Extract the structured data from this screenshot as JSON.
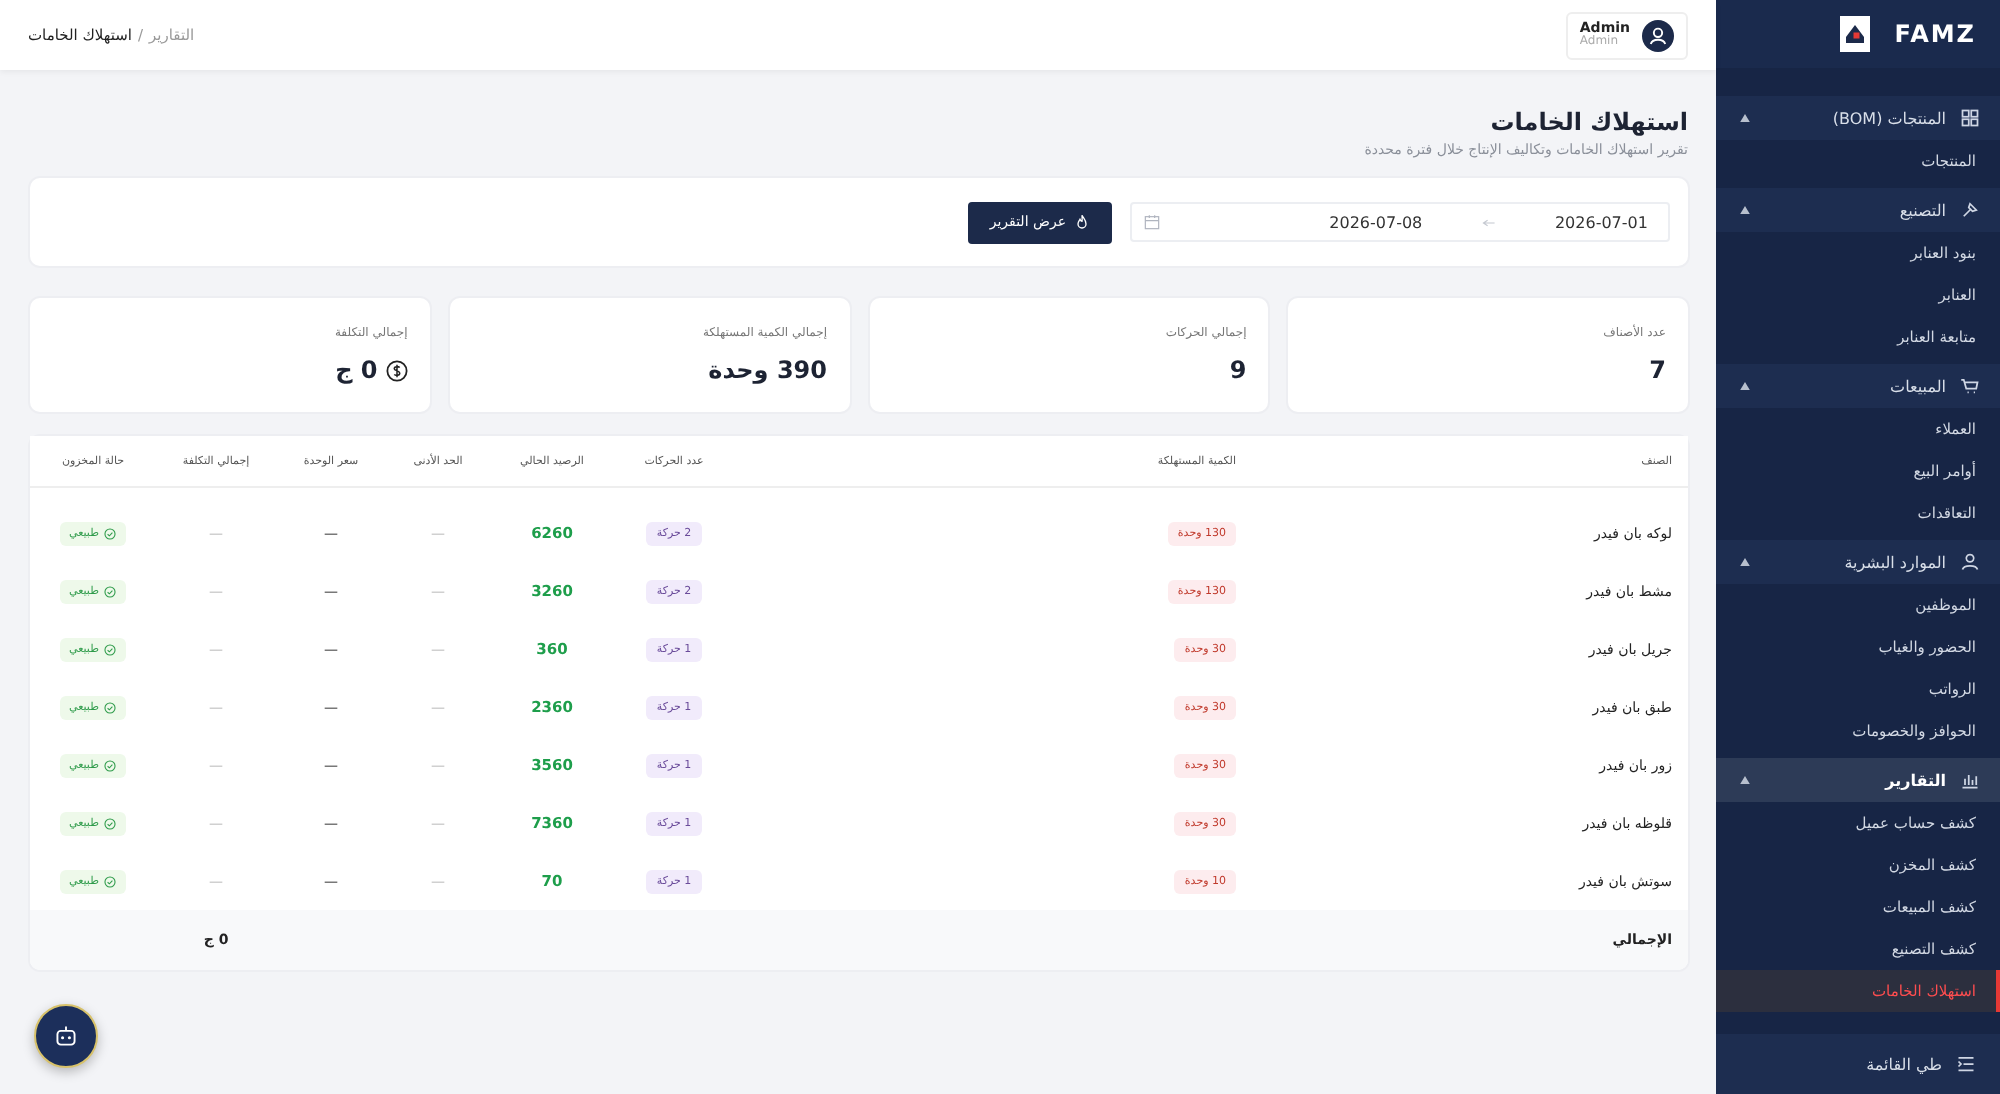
{
  "breadcrumb": {
    "parent": "التقارير",
    "separator": "/",
    "current": "استهلاك الخامات"
  },
  "user": {
    "name": "Admin",
    "role": "Admin"
  },
  "page": {
    "title": "استهلاك الخامات",
    "subtitle": "تقرير استهلاك الخامات وتكاليف الإنتاج خلال فترة محددة"
  },
  "filter": {
    "from": "2026-07-01",
    "to": "2026-07-08",
    "button": "عرض التقرير"
  },
  "stats": [
    {
      "label": "عدد الأصناف",
      "value": "7"
    },
    {
      "label": "إجمالي الحركات",
      "value": "9"
    },
    {
      "label": "إجمالي الكمية المستهلكة",
      "value": "390 وحدة"
    },
    {
      "label": "إجمالي التكلفة",
      "value": "0 ج",
      "kind": "money"
    }
  ],
  "table": {
    "columns": [
      "الصنف",
      "الكمية المستهلكة",
      "عدد الحركات",
      "الرصيد الحالي",
      "الحد الأدنى",
      "سعر الوحدة",
      "إجمالي التكلفة",
      "حالة المخزون"
    ],
    "rows": [
      {
        "item": "لوكه بان فيدر",
        "consumed": "130 وحدة",
        "moves": "2 حركة",
        "balance": "6260",
        "min": "—",
        "price": "—",
        "total": "—",
        "status": "طبيعي"
      },
      {
        "item": "مشط بان فيدر",
        "consumed": "130 وحدة",
        "moves": "2 حركة",
        "balance": "3260",
        "min": "—",
        "price": "—",
        "total": "—",
        "status": "طبيعي"
      },
      {
        "item": "جريل بان فيدر",
        "consumed": "30 وحدة",
        "moves": "1 حركة",
        "balance": "360",
        "min": "—",
        "price": "—",
        "total": "—",
        "status": "طبيعي"
      },
      {
        "item": "طبق بان فيدر",
        "consumed": "30 وحدة",
        "moves": "1 حركة",
        "balance": "2360",
        "min": "—",
        "price": "—",
        "total": "—",
        "status": "طبيعي"
      },
      {
        "item": "زور بان فيدر",
        "consumed": "30 وحدة",
        "moves": "1 حركة",
        "balance": "3560",
        "min": "—",
        "price": "—",
        "total": "—",
        "status": "طبيعي"
      },
      {
        "item": "قلوظه بان فيدر",
        "consumed": "30 وحدة",
        "moves": "1 حركة",
        "balance": "7360",
        "min": "—",
        "price": "—",
        "total": "—",
        "status": "طبيعي"
      },
      {
        "item": "سوتش بان فيدر",
        "consumed": "10 وحدة",
        "moves": "1 حركة",
        "balance": "70",
        "min": "—",
        "price": "—",
        "total": "—",
        "status": "طبيعي"
      }
    ],
    "footer": {
      "label": "الإجمالي",
      "total": "0 ج"
    }
  },
  "sidebar": {
    "brand": "FAMZ",
    "groups": [
      {
        "label": "المنتجات (BOM)",
        "expanded": true,
        "selected": false,
        "children": [
          {
            "label": "المنتجات",
            "selected": false
          }
        ]
      },
      {
        "label": "التصنيع",
        "expanded": true,
        "selected": false,
        "children": [
          {
            "label": "بنود العنابر",
            "selected": false
          },
          {
            "label": "العنابر",
            "selected": false
          },
          {
            "label": "متابعة العنابر",
            "selected": false
          }
        ]
      },
      {
        "label": "المبيعات",
        "expanded": true,
        "selected": false,
        "children": [
          {
            "label": "العملاء",
            "selected": false
          },
          {
            "label": "أوامر البيع",
            "selected": false
          },
          {
            "label": "التعاقدات",
            "selected": false
          }
        ]
      },
      {
        "label": "الموارد البشرية",
        "expanded": true,
        "selected": false,
        "children": [
          {
            "label": "الموظفين",
            "selected": false
          },
          {
            "label": "الحضور والغياب",
            "selected": false
          },
          {
            "label": "الرواتب",
            "selected": false
          },
          {
            "label": "الحوافز والخصومات",
            "selected": false
          }
        ]
      },
      {
        "label": "التقارير",
        "expanded": true,
        "selected": true,
        "children": [
          {
            "label": "كشف حساب عميل",
            "selected": false
          },
          {
            "label": "كشف المخزن",
            "selected": false
          },
          {
            "label": "كشف المبيعات",
            "selected": false
          },
          {
            "label": "كشف التصنيع",
            "selected": false
          },
          {
            "label": "استهلاك الخامات",
            "selected": true
          }
        ]
      }
    ],
    "collapse": "طي القائمة"
  }
}
